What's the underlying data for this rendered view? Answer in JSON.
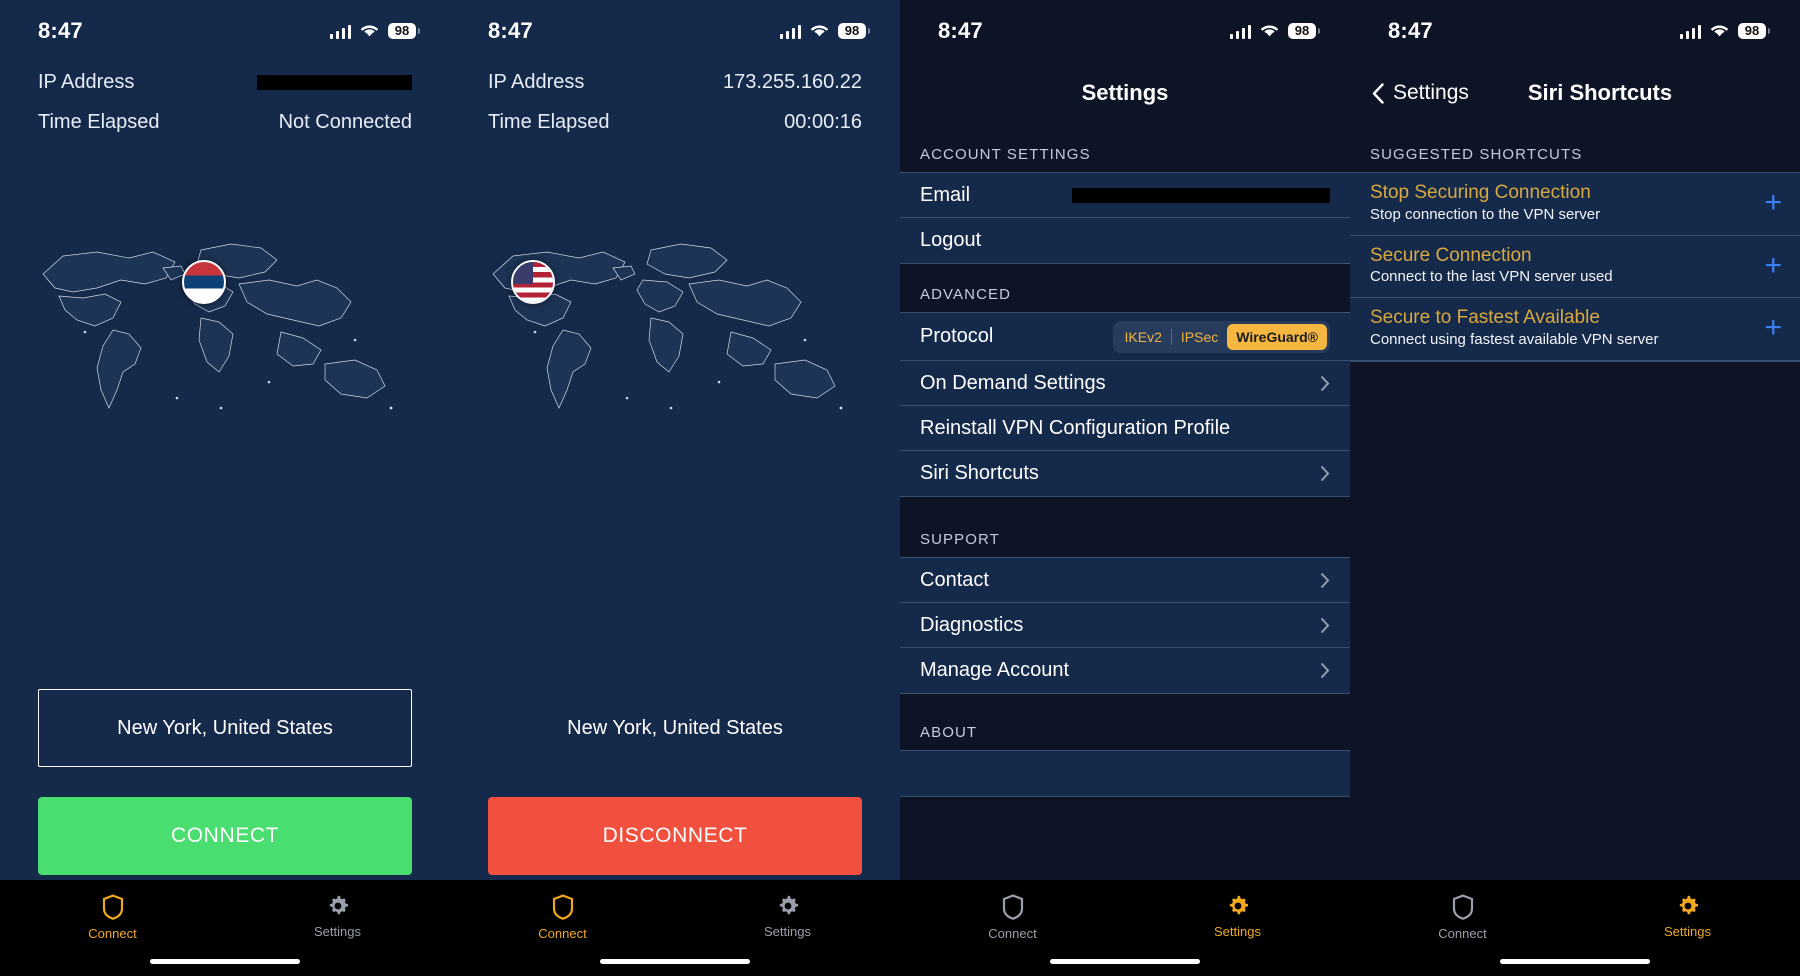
{
  "status_bar": {
    "time": "8:47",
    "battery": "98",
    "signal_icon": "cellular-bars-icon",
    "wifi_icon": "wifi-icon"
  },
  "colors": {
    "accent_amber": "#f0a81f",
    "connect_green": "#4ade71",
    "disconnect_red": "#f2503f",
    "row_bg": "#15294a",
    "screen_bg": "#0d1426",
    "plus_blue": "#3b82f6",
    "shortcut_title": "#d9a93f"
  },
  "screen_connect_disconnected": {
    "ip_label": "IP Address",
    "ip_value": "",
    "ip_redacted": true,
    "time_label": "Time Elapsed",
    "time_value": "Not Connected",
    "flag_icon": "serbia-flag-icon",
    "server": "New York, United States",
    "action_button": "CONNECT"
  },
  "screen_connect_connected": {
    "ip_label": "IP Address",
    "ip_value": "173.255.160.22",
    "ip_redacted": false,
    "time_label": "Time Elapsed",
    "time_value": "00:00:16",
    "flag_icon": "usa-flag-icon",
    "server": "New York, United States",
    "action_button": "DISCONNECT"
  },
  "screen_settings": {
    "title": "Settings",
    "sections": [
      {
        "label": "ACCOUNT SETTINGS",
        "rows": [
          {
            "label": "Email",
            "value": "",
            "redacted": true,
            "chevron": false
          },
          {
            "label": "Logout",
            "value": "",
            "redacted": false,
            "chevron": false
          }
        ]
      },
      {
        "label": "ADVANCED",
        "rows": [
          {
            "label": "Protocol",
            "value": "",
            "redacted": false,
            "chevron": false,
            "segmented": true
          },
          {
            "label": "On Demand Settings",
            "value": "",
            "redacted": false,
            "chevron": true
          },
          {
            "label": "Reinstall VPN Configuration Profile",
            "value": "",
            "redacted": false,
            "chevron": false
          },
          {
            "label": "Siri Shortcuts",
            "value": "",
            "redacted": false,
            "chevron": true
          }
        ]
      },
      {
        "label": "SUPPORT",
        "rows": [
          {
            "label": "Contact",
            "value": "",
            "redacted": false,
            "chevron": true
          },
          {
            "label": "Diagnostics",
            "value": "",
            "redacted": false,
            "chevron": true
          },
          {
            "label": "Manage Account",
            "value": "",
            "redacted": false,
            "chevron": true
          }
        ]
      },
      {
        "label": "ABOUT",
        "rows": []
      }
    ],
    "protocol_options": [
      "IKEv2",
      "IPSec",
      "WireGuard®"
    ],
    "protocol_selected": "WireGuard®"
  },
  "screen_siri_shortcuts": {
    "back_label": "Settings",
    "title": "Siri Shortcuts",
    "section_label": "SUGGESTED SHORTCUTS",
    "shortcuts": [
      {
        "title": "Stop Securing Connection",
        "subtitle": "Stop connection to the VPN server",
        "add_icon": "plus-icon"
      },
      {
        "title": "Secure Connection",
        "subtitle": "Connect to the last VPN server used",
        "add_icon": "plus-icon"
      },
      {
        "title": "Secure to Fastest Available",
        "subtitle": "Connect using fastest available VPN server",
        "add_icon": "plus-icon"
      }
    ]
  },
  "tab_bar": {
    "connect_label": "Connect",
    "settings_label": "Settings",
    "connect_icon": "shield-icon",
    "settings_icon": "gear-icon"
  }
}
